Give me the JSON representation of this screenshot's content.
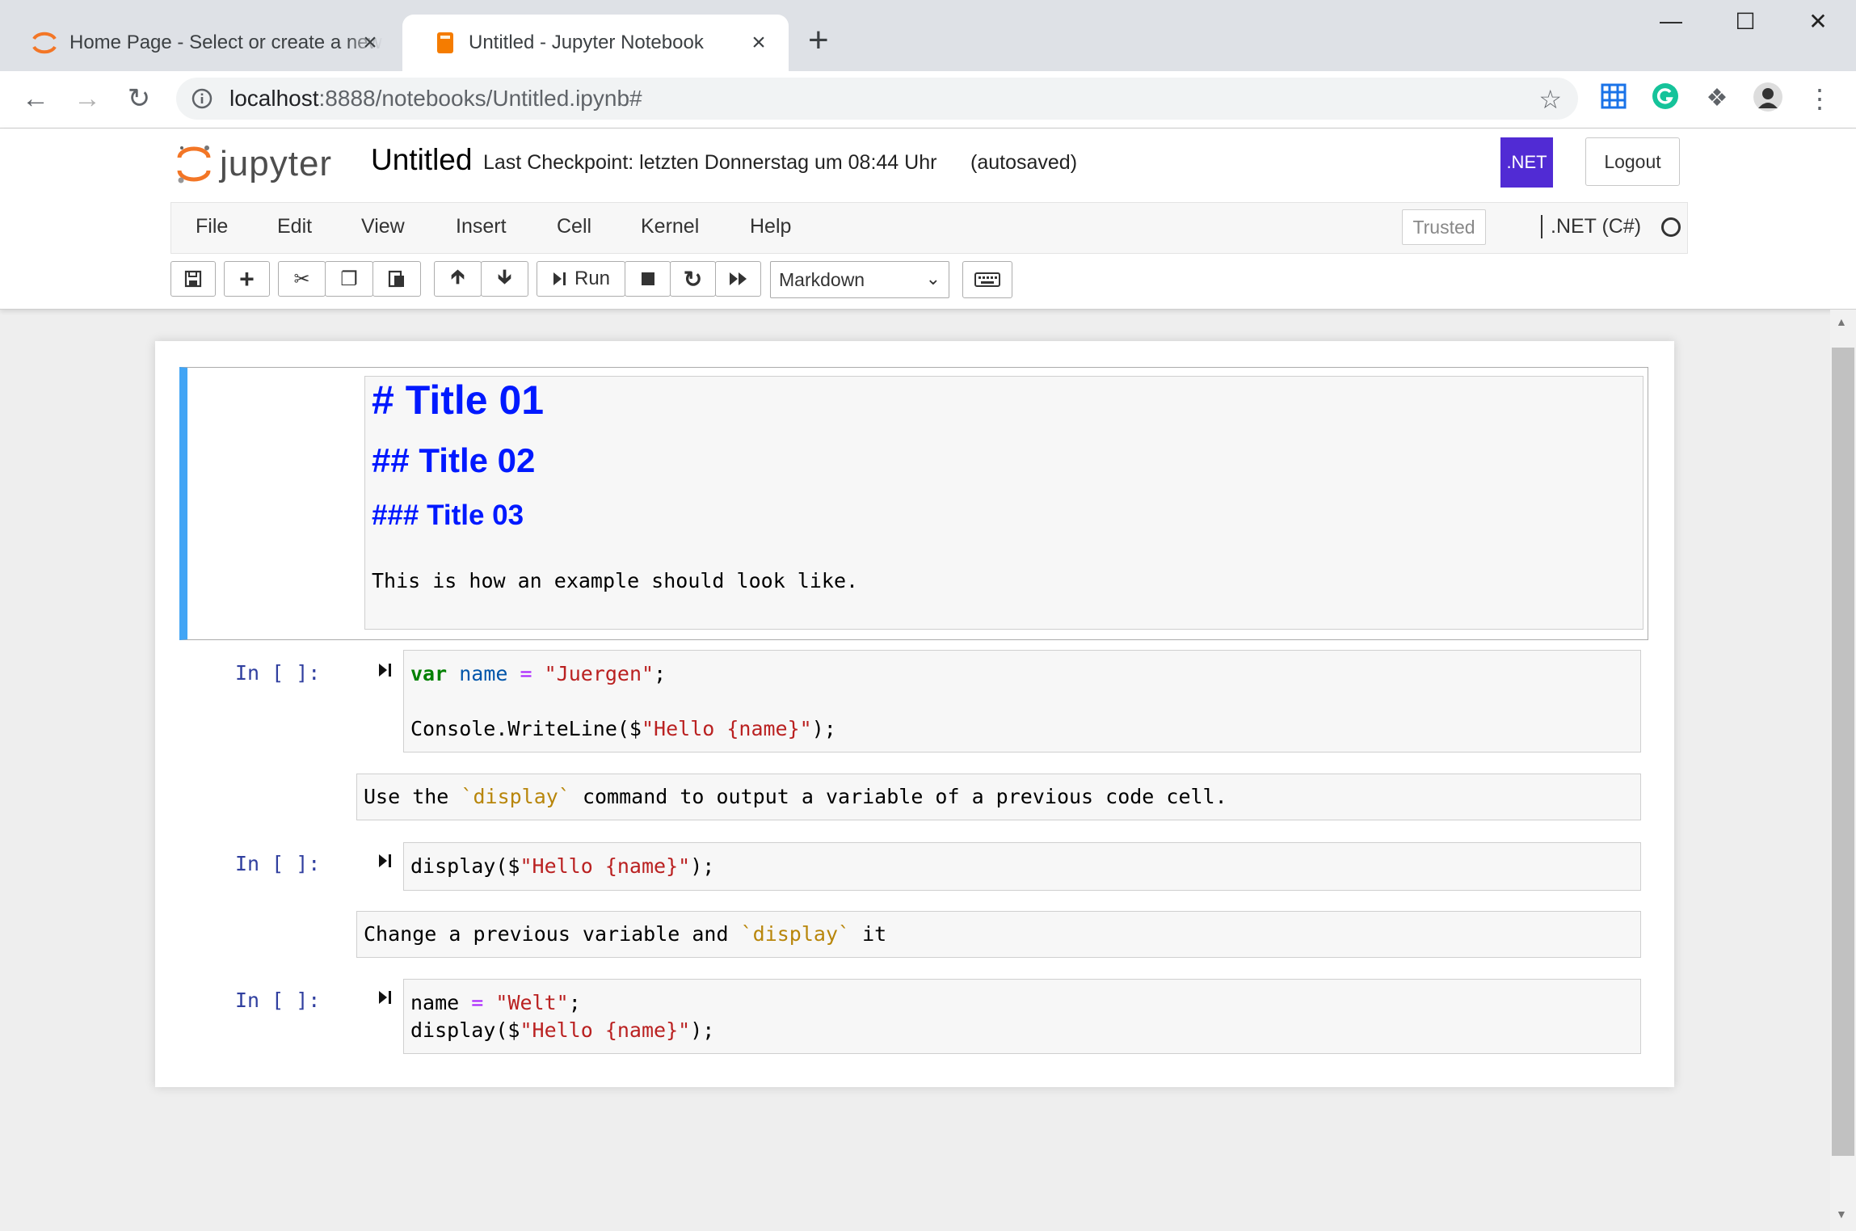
{
  "browser": {
    "tabs": [
      {
        "title": "Home Page - Select or create a new notebook",
        "active": false
      },
      {
        "title": "Untitled - Jupyter Notebook",
        "active": true
      }
    ],
    "new_tab_symbol": "+",
    "url_host": "localhost",
    "url_path": ":8888/notebooks/Untitled.ipynb#"
  },
  "jupyter": {
    "logo_text": "jupyter",
    "notebook_name": "Untitled",
    "checkpoint": "Last Checkpoint: letzten Donnerstag um 08:44 Uhr",
    "autosave": "(autosaved)",
    "net_badge": ".NET",
    "logout_label": "Logout",
    "menu": [
      "File",
      "Edit",
      "View",
      "Insert",
      "Cell",
      "Kernel",
      "Help"
    ],
    "trusted_label": "Trusted",
    "kernel_name": ".NET (C#)",
    "run_label": "Run",
    "cell_type": "Markdown"
  },
  "cells": {
    "markdown1": {
      "h1": "# Title 01",
      "h2": "## Title 02",
      "h3": "### Title 03",
      "text": "This is how an example should look like."
    },
    "code1": {
      "prompt": "In [ ]:",
      "line1": {
        "kw": "var",
        "var": "name",
        "op": "=",
        "str": "\"Juergen\"",
        "end": ";"
      },
      "line2": {
        "pre": "Console.WriteLine($",
        "str_a": "\"Hello ",
        "interp": "{name}",
        "str_b": "\"",
        "end": ");"
      }
    },
    "markdown2": {
      "pre": "Use the ",
      "code": "`display`",
      "post": " command to output a variable of a previous code cell."
    },
    "code2": {
      "prompt": "In [ ]:",
      "line1": {
        "pre": "display($",
        "str_a": "\"Hello ",
        "interp": "{name}",
        "str_b": "\"",
        "end": ");"
      }
    },
    "markdown3": {
      "pre": "Change a previous variable and ",
      "code": "`display`",
      "post": " it"
    },
    "code3": {
      "prompt": "In [ ]:",
      "line1": {
        "var": "name",
        "op": "=",
        "str": "\"Welt\"",
        "end": ";"
      },
      "line2": {
        "pre": "display($",
        "str_a": "\"Hello ",
        "interp": "{name}",
        "str_b": "\"",
        "end": ");"
      }
    }
  },
  "colors": {
    "net_badge": "#512bd4",
    "selected_cell_border": "#42a5f5",
    "heading": "#0019ff",
    "prompt": "#303f9f"
  }
}
